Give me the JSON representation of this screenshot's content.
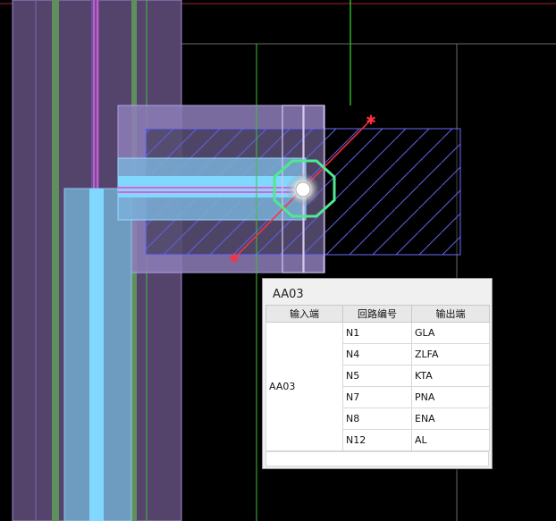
{
  "tooltip": {
    "title": "AA03",
    "headers": [
      "输入端",
      "回路编号",
      "输出端"
    ],
    "input_terminal": "AA03",
    "rows": [
      {
        "circuit": "N1",
        "output": "GLA"
      },
      {
        "circuit": "N4",
        "output": "ZLFA"
      },
      {
        "circuit": "N5",
        "output": "KTA"
      },
      {
        "circuit": "N7",
        "output": "PNA"
      },
      {
        "circuit": "N8",
        "output": "ENA"
      },
      {
        "circuit": "N12",
        "output": "AL"
      }
    ]
  },
  "colors": {
    "background": "#000000",
    "wall_purple": "#5a4a78",
    "column_blue": "#6ea4cc",
    "pipe_cyan": "#80d8ff",
    "hatch": "#6a6aff",
    "green_line": "#3cc33c",
    "red_marker": "#ff3040",
    "octagon": "#50e890",
    "magenta": "#e060d0"
  }
}
